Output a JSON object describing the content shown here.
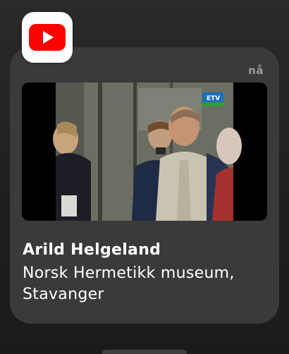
{
  "app": {
    "name": "YouTube",
    "icon": "youtube-logo-icon",
    "brand_color": "#ff0000"
  },
  "notification": {
    "time": "nå",
    "title": "Arild Helgeland",
    "body": "Norsk Hermetikk museum, Stavanger",
    "thumbnail_icon": "video-thumbnail",
    "card_color": "#3a3a3a",
    "text_color": "#ffffff",
    "time_color": "#9b9b9b"
  }
}
